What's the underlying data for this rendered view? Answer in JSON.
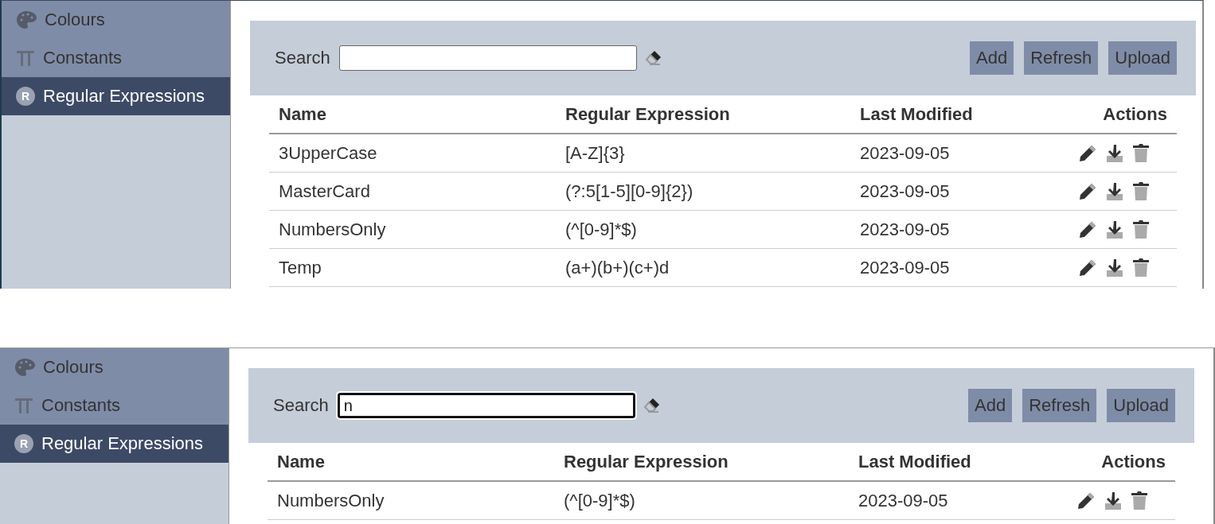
{
  "panels": [
    {
      "sidebar": {
        "items": [
          {
            "kind": "palette",
            "label": "Colours",
            "selected": false
          },
          {
            "kind": "pi",
            "label": "Constants",
            "selected": false
          },
          {
            "kind": "letter",
            "icon_text": "R",
            "label": "Regular Expressions",
            "selected": true
          }
        ]
      },
      "search": {
        "label": "Search",
        "focused": false
      },
      "buttons": [
        "Add",
        "Refresh",
        "Upload"
      ],
      "table": {
        "columns": [
          "Name",
          "Regular Expression",
          "Last Modified",
          "Actions"
        ],
        "rows": [
          {
            "name": "3UpperCase",
            "regex": "[A-Z]{3}",
            "modified": "2023-09-05"
          },
          {
            "name": "MasterCard",
            "regex": "(?:5[1-5][0-9]{2})",
            "modified": "2023-09-05"
          },
          {
            "name": "NumbersOnly",
            "regex": "(^[0-9]*$)",
            "modified": "2023-09-05"
          },
          {
            "name": "Temp",
            "regex": "(a+)(b+)(c+)d",
            "modified": "2023-09-05"
          }
        ]
      }
    },
    {
      "sidebar": {
        "items": [
          {
            "kind": "palette",
            "label": "Colours",
            "selected": false
          },
          {
            "kind": "pi",
            "label": "Constants",
            "selected": false
          },
          {
            "kind": "letter",
            "icon_text": "R",
            "label": "Regular Expressions",
            "selected": true
          }
        ]
      },
      "search": {
        "label": "Search",
        "value": "n",
        "focused": true
      },
      "buttons": [
        "Add",
        "Refresh",
        "Upload"
      ],
      "table": {
        "columns": [
          "Name",
          "Regular Expression",
          "Last Modified",
          "Actions"
        ],
        "rows": [
          {
            "name": "NumbersOnly",
            "regex": "(^[0-9]*$)",
            "modified": "2023-09-05"
          }
        ]
      }
    }
  ]
}
